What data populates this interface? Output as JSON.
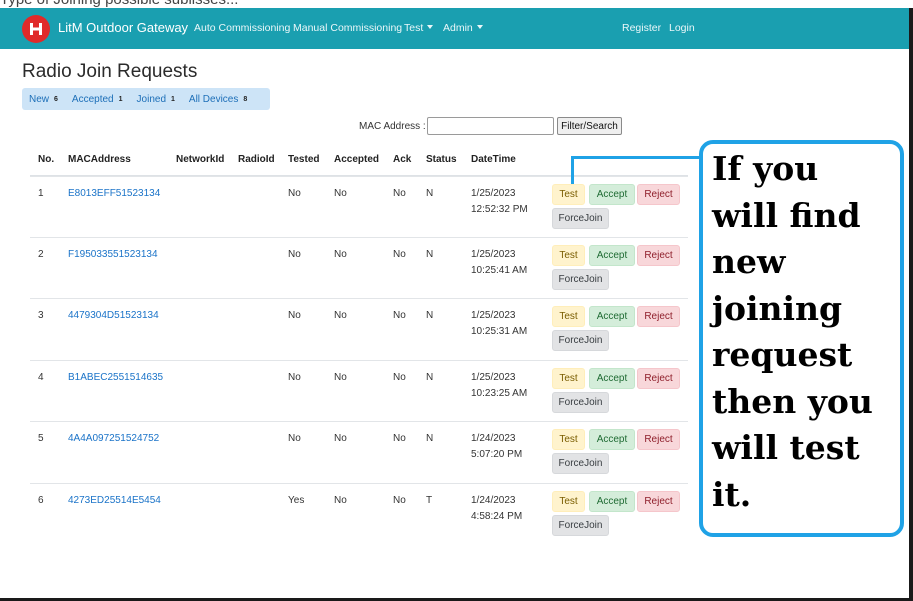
{
  "top_strip_text": "Type of Joining possible sublisses...",
  "navbar": {
    "brand": "LitM Outdoor Gateway",
    "logo_icon": "havells-logo-icon",
    "links": [
      {
        "label": "Auto Commissioning",
        "dropdown": false
      },
      {
        "label": "Manual Commissioning",
        "dropdown": false
      },
      {
        "label": "Test",
        "dropdown": true
      },
      {
        "label": "Admin",
        "dropdown": true
      }
    ],
    "register_label": "Register",
    "login_label": "Login",
    "color": "#1a9fb0"
  },
  "page_title": "Radio Join Requests",
  "tabs": [
    {
      "label": "New",
      "count": "6"
    },
    {
      "label": "Accepted",
      "count": "1"
    },
    {
      "label": "Joined",
      "count": "1"
    },
    {
      "label": "All Devices",
      "count": "8"
    }
  ],
  "filter": {
    "label": "MAC Address :",
    "value": "",
    "button_label": "Filter/Search"
  },
  "table": {
    "columns": [
      "No.",
      "MACAddress",
      "NetworkId",
      "RadioId",
      "Tested",
      "Accepted",
      "Ack",
      "Status",
      "DateTime"
    ],
    "action_labels": {
      "test": "Test",
      "accept": "Accept",
      "reject": "Reject",
      "forcejoin": "ForceJoin"
    },
    "rows": [
      {
        "no": "1",
        "mac": "E8013EFF51523134",
        "network_id": "",
        "radio_id": "",
        "tested": "No",
        "accepted": "No",
        "ack": "No",
        "status": "N",
        "date": "1/25/2023",
        "time": "12:52:32 PM"
      },
      {
        "no": "2",
        "mac": "F195033551523134",
        "network_id": "",
        "radio_id": "",
        "tested": "No",
        "accepted": "No",
        "ack": "No",
        "status": "N",
        "date": "1/25/2023",
        "time": "10:25:41 AM"
      },
      {
        "no": "3",
        "mac": "4479304D51523134",
        "network_id": "",
        "radio_id": "",
        "tested": "No",
        "accepted": "No",
        "ack": "No",
        "status": "N",
        "date": "1/25/2023",
        "time": "10:25:31 AM"
      },
      {
        "no": "4",
        "mac": "B1ABEC2551514635",
        "network_id": "",
        "radio_id": "",
        "tested": "No",
        "accepted": "No",
        "ack": "No",
        "status": "N",
        "date": "1/25/2023",
        "time": "10:23:25 AM"
      },
      {
        "no": "5",
        "mac": "4A4A097251524752",
        "network_id": "",
        "radio_id": "",
        "tested": "No",
        "accepted": "No",
        "ack": "No",
        "status": "N",
        "date": "1/24/2023",
        "time": "5:07:20 PM"
      },
      {
        "no": "6",
        "mac": "4273ED25514E5454",
        "network_id": "",
        "radio_id": "",
        "tested": "Yes",
        "accepted": "No",
        "ack": "No",
        "status": "T",
        "date": "1/24/2023",
        "time": "4:58:24 PM"
      }
    ]
  },
  "callout": {
    "lines": [
      "If you",
      "will find",
      "new",
      "joining",
      "request",
      "then you",
      "will test",
      "it."
    ],
    "border_color": "#1fa2e6"
  }
}
